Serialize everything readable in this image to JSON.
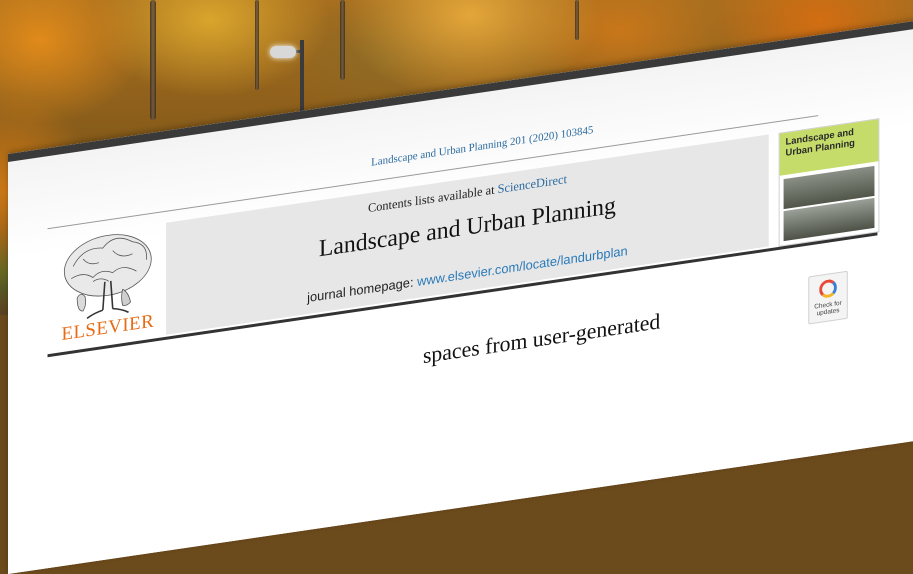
{
  "citation": "Landscape and Urban Planning 201 (2020) 103845",
  "contents_prefix": "Contents lists available at ",
  "contents_link": "ScienceDirect",
  "journal_title": "Landscape and Urban Planning",
  "homepage_prefix": "journal homepage: ",
  "homepage_url": "www.elsevier.com/locate/landurbplan",
  "publisher": "ELSEVIER",
  "cover_title": "Landscape and Urban Planning",
  "check_badge": "Check for updates",
  "article_title_fragment": "spaces from user-generated",
  "colors": {
    "link": "#2a6aa0",
    "publisher_orange": "#e86a12",
    "cover_band": "#c5dc6a"
  }
}
